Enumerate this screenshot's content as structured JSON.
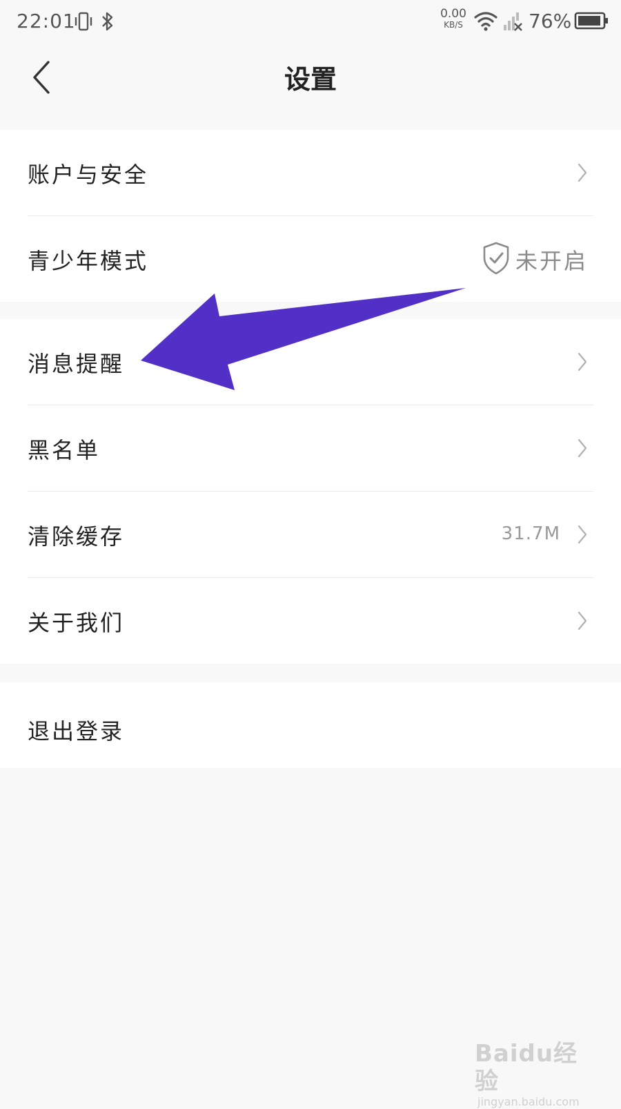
{
  "status_bar": {
    "time": "22:01",
    "net_speed_value": "0.00",
    "net_speed_unit": "KB/S",
    "battery": "76%"
  },
  "header": {
    "title": "设置"
  },
  "group1": {
    "account_security": "账户与安全",
    "teen_mode": "青少年模式",
    "teen_mode_status": "未开启"
  },
  "group2": {
    "notifications": "消息提醒",
    "blacklist": "黑名单",
    "clear_cache": "清除缓存",
    "cache_size": "31.7M",
    "about_us": "关于我们"
  },
  "group3": {
    "logout": "退出登录"
  },
  "annotation": {
    "arrow_color": "#5230c8"
  },
  "watermark": {
    "brand": "Baidu经验",
    "url": "jingyan.baidu.com"
  }
}
